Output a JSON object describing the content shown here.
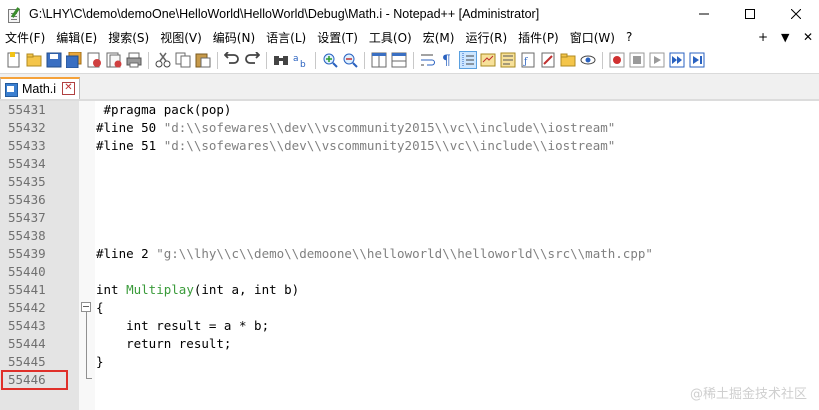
{
  "window": {
    "title": "G:\\LHY\\C\\demo\\demoOne\\HelloWorld\\HelloWorld\\Debug\\Math.i - Notepad++ [Administrator]",
    "minimize_icon": "minimize-icon",
    "maximize_icon": "maximize-icon",
    "close_icon": "close-icon"
  },
  "menu": {
    "items": [
      "文件(F)",
      "编辑(E)",
      "搜索(S)",
      "视图(V)",
      "编码(N)",
      "语言(L)",
      "设置(T)",
      "工具(O)",
      "宏(M)",
      "运行(R)",
      "插件(P)",
      "窗口(W)",
      "?"
    ],
    "right_plus": "+",
    "right_down": "▼",
    "right_close": "✕"
  },
  "tab": {
    "label": "Math.i",
    "close_label": "✕"
  },
  "editor": {
    "lines": [
      {
        "num": "55431",
        "parts": [
          {
            "t": " #pragma pack(pop)",
            "c": ""
          }
        ]
      },
      {
        "num": "55432",
        "parts": [
          {
            "t": "#line 50 ",
            "c": ""
          },
          {
            "t": "\"d:\\\\sofewares\\\\dev\\\\vscommunity2015\\\\vc\\\\include\\\\iostream\"",
            "c": "str"
          }
        ]
      },
      {
        "num": "55433",
        "parts": [
          {
            "t": "#line 51 ",
            "c": ""
          },
          {
            "t": "\"d:\\\\sofewares\\\\dev\\\\vscommunity2015\\\\vc\\\\include\\\\iostream\"",
            "c": "str"
          }
        ]
      },
      {
        "num": "55434",
        "parts": []
      },
      {
        "num": "55435",
        "parts": []
      },
      {
        "num": "55436",
        "parts": []
      },
      {
        "num": "55437",
        "parts": []
      },
      {
        "num": "55438",
        "parts": []
      },
      {
        "num": "55439",
        "parts": [
          {
            "t": "#line 2 ",
            "c": ""
          },
          {
            "t": "\"g:\\\\lhy\\\\c\\\\demo\\\\demoone\\\\helloworld\\\\helloworld\\\\src\\\\math.cpp\"",
            "c": "str"
          }
        ]
      },
      {
        "num": "55440",
        "parts": []
      },
      {
        "num": "55441",
        "parts": [
          {
            "t": "int ",
            "c": ""
          },
          {
            "t": "Multiplay",
            "c": "func"
          },
          {
            "t": "(int a, int b)",
            "c": ""
          }
        ]
      },
      {
        "num": "55442",
        "parts": [
          {
            "t": "{",
            "c": ""
          }
        ]
      },
      {
        "num": "55443",
        "parts": [
          {
            "t": "    int result = a * b;",
            "c": ""
          }
        ]
      },
      {
        "num": "55444",
        "parts": [
          {
            "t": "    return result;",
            "c": ""
          }
        ]
      },
      {
        "num": "55445",
        "parts": [
          {
            "t": "}",
            "c": ""
          }
        ]
      },
      {
        "num": "55446",
        "parts": []
      }
    ]
  },
  "watermark": "@稀土掘金技术社区",
  "colors": {
    "string": "#808080",
    "function": "#3a9b3a",
    "highlight": "#e0302a",
    "tab_accent": "#f5a23a"
  }
}
